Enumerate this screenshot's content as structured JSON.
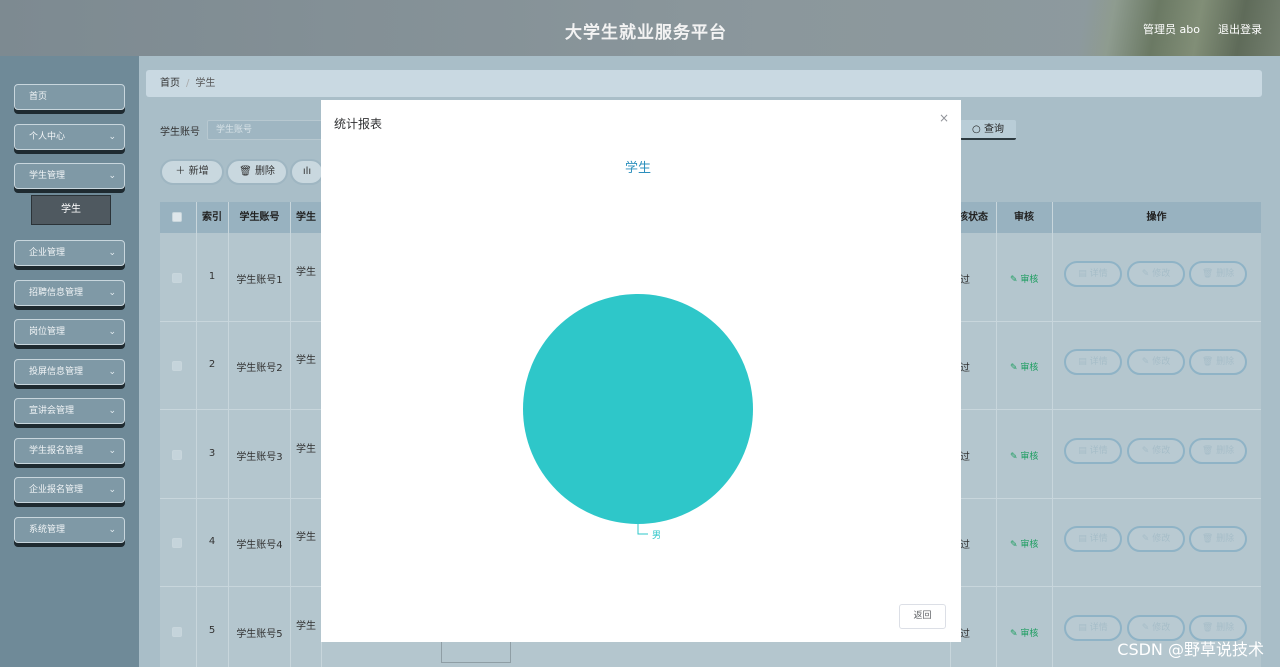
{
  "header": {
    "title": "大学生就业服务平台",
    "user": "管理员 abo",
    "logout": "退出登录"
  },
  "sidebar": {
    "items": [
      {
        "label": "首页",
        "has_children": false
      },
      {
        "label": "个人中心",
        "has_children": true
      },
      {
        "label": "学生管理",
        "has_children": true
      },
      {
        "label": "企业管理",
        "has_children": true
      },
      {
        "label": "招聘信息管理",
        "has_children": true
      },
      {
        "label": "岗位管理",
        "has_children": true
      },
      {
        "label": "投屏信息管理",
        "has_children": true
      },
      {
        "label": "宣讲会管理",
        "has_children": true
      },
      {
        "label": "学生报名管理",
        "has_children": true
      },
      {
        "label": "企业报名管理",
        "has_children": true
      },
      {
        "label": "系统管理",
        "has_children": true
      }
    ],
    "active_sub": "学生"
  },
  "breadcrumb": {
    "home": "首页",
    "current": "学生"
  },
  "search": {
    "label": "学生账号",
    "placeholder": "学生账号",
    "button": "查询"
  },
  "toolbar": {
    "add": "新增",
    "delete": "删除"
  },
  "table": {
    "headers": {
      "index": "索引",
      "account": "学生账号",
      "name": "学生",
      "status": "核状态",
      "audit": "审核",
      "actions": "操作"
    },
    "rows": [
      {
        "index": "1",
        "account": "学生账号1",
        "name": "学生",
        "status": "过"
      },
      {
        "index": "2",
        "account": "学生账号2",
        "name": "学生",
        "status": "过"
      },
      {
        "index": "3",
        "account": "学生账号3",
        "name": "学生",
        "status": "过"
      },
      {
        "index": "4",
        "account": "学生账号4",
        "name": "学生",
        "status": "过"
      },
      {
        "index": "5",
        "account": "学生账号5",
        "name": "学生",
        "status": "过"
      }
    ],
    "audit_label": "审核",
    "action_labels": {
      "detail": "详情",
      "edit": "修改",
      "delete": "删除"
    }
  },
  "modal": {
    "title": "统计报表",
    "close": "×",
    "back": "返回"
  },
  "chart_data": {
    "type": "pie",
    "title": "学生",
    "categories": [
      "男"
    ],
    "values": [
      1
    ],
    "colors": [
      "#2ec7c9"
    ]
  },
  "watermark": "CSDN @野草说技术"
}
